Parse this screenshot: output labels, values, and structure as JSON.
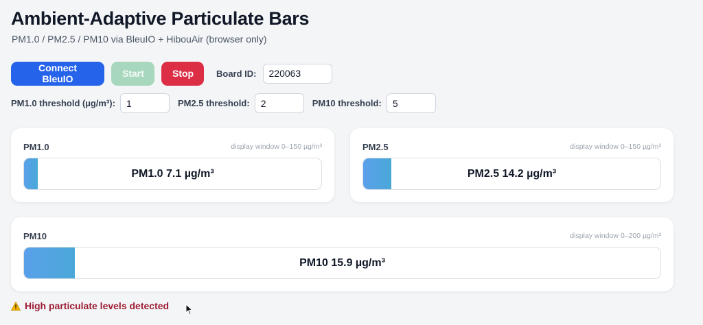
{
  "header": {
    "title": "Ambient-Adaptive Particulate Bars",
    "subtitle": "PM1.0 / PM2.5 / PM10 via BleuIO + HibouAir (browser only)"
  },
  "controls": {
    "connect_label": "Connect BleuIO",
    "start_label": "Start",
    "stop_label": "Stop",
    "board_label": "Board ID:",
    "board_value": "220063"
  },
  "thresholds": {
    "pm1_label": "PM1.0 threshold (µg/m³):",
    "pm1_value": "1",
    "pm25_label": "PM2.5 threshold:",
    "pm25_value": "2",
    "pm10_label": "PM10 threshold:",
    "pm10_value": "5"
  },
  "cards": {
    "pm1": {
      "title": "PM1.0",
      "window": "display window 0–150 µg/m³",
      "reading": "PM1.0 7.1 µg/m³",
      "value": 7.1,
      "window_max": 150
    },
    "pm25": {
      "title": "PM2.5",
      "window": "display window 0–150 µg/m³",
      "reading": "PM2.5 14.2 µg/m³",
      "value": 14.2,
      "window_max": 150
    },
    "pm10": {
      "title": "PM10",
      "window": "display window 0–200 µg/m³",
      "reading": "PM10 15.9 µg/m³",
      "value": 15.9,
      "window_max": 200
    }
  },
  "alert": {
    "text": "High particulate levels detected",
    "icon": "warning-icon"
  },
  "colors": {
    "connect": "#2563eb",
    "start": "#a7d7bd",
    "stop": "#dc2f46",
    "alert": "#9d1c32"
  }
}
